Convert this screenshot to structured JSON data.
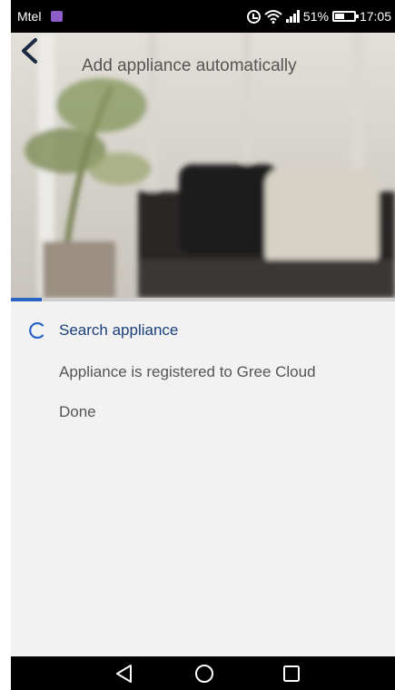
{
  "status_bar": {
    "carrier": "Mtel",
    "battery_percent": "51%",
    "battery_level": 0.51,
    "time": "17:05",
    "icons": [
      "app-badge-icon",
      "alarm-icon",
      "wifi-icon",
      "signal-icon",
      "battery-icon"
    ]
  },
  "header": {
    "back_icon": "chevron-left-icon",
    "title": "Add appliance automatically"
  },
  "progress": {
    "fraction": 0.08,
    "accent_color": "#2b63c4"
  },
  "steps": [
    {
      "label": "Search appliance",
      "state": "in-progress"
    },
    {
      "label": "Appliance is registered to Gree Cloud",
      "state": "pending"
    },
    {
      "label": "Done",
      "state": "pending"
    }
  ],
  "nav_bar": {
    "buttons": [
      "back-triangle-icon",
      "home-circle-icon",
      "recents-square-icon"
    ]
  },
  "colors": {
    "active_step": "#1a3f7a",
    "inactive_step": "#555555",
    "spinner": "#2b63c4"
  }
}
